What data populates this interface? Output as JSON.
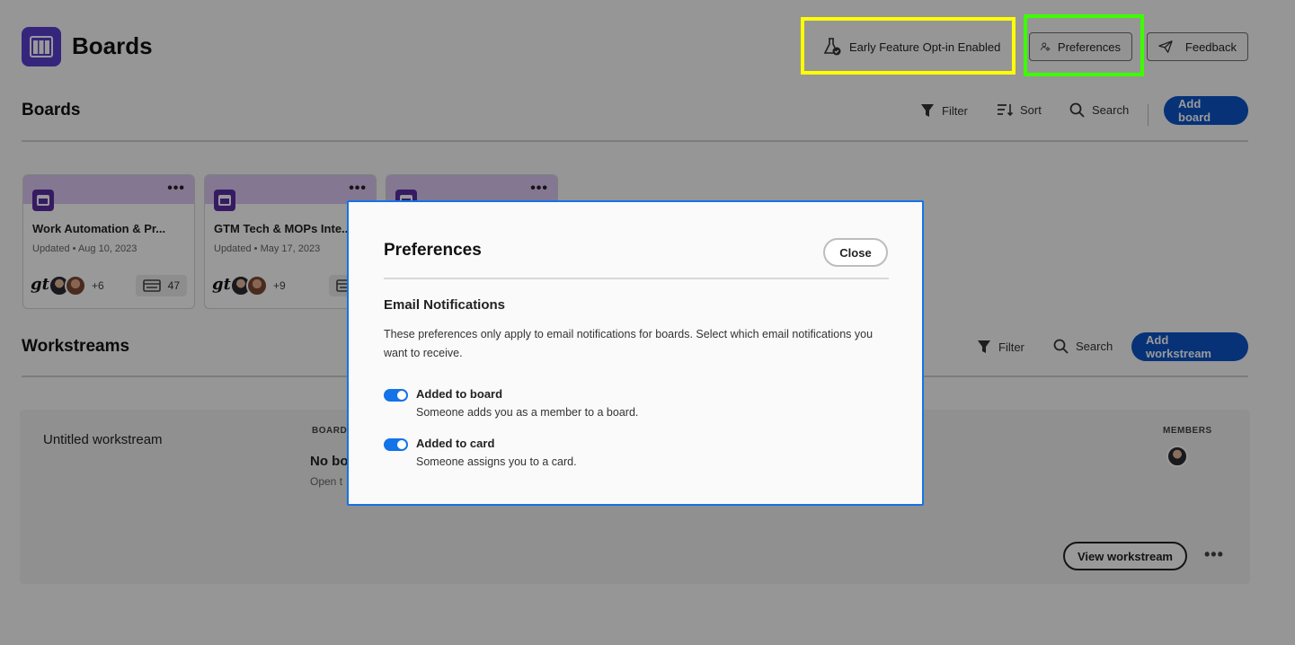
{
  "header": {
    "app_title": "Boards",
    "early_feature_label": "Early Feature Opt-in Enabled",
    "preferences_label": "Preferences",
    "feedback_label": "Feedback"
  },
  "boards_section": {
    "title": "Boards",
    "filter_label": "Filter",
    "sort_label": "Sort",
    "search_label": "Search",
    "add_label": "Add board",
    "cards": [
      {
        "name": "Work Automation & Pr...",
        "updated_label": "Updated",
        "date": "Aug 10, 2023",
        "more_members": "+6",
        "count": "47"
      },
      {
        "name": "GTM Tech & MOPs Inte...",
        "updated_label": "Updated",
        "date": "May 17, 2023",
        "more_members": "+9",
        "count": ""
      },
      {
        "name": "",
        "updated_label": "",
        "date": "",
        "more_members": "",
        "count": ""
      }
    ]
  },
  "workstreams_section": {
    "title": "Workstreams",
    "filter_label": "Filter",
    "search_label": "Search",
    "add_label": "Add workstream",
    "item": {
      "name": "Untitled workstream",
      "boards_col": "BOARD",
      "empty_title": "No bo",
      "empty_sub": "Open t",
      "members_col": "MEMBERS",
      "view_label": "View workstream"
    }
  },
  "dialog": {
    "title": "Preferences",
    "close_label": "Close",
    "section_title": "Email Notifications",
    "description": "These preferences only apply to email notifications for boards. Select which email notifications you want to receive.",
    "options": [
      {
        "label": "Added to board",
        "sub": "Someone adds you as a member to a board.",
        "enabled": true
      },
      {
        "label": "Added to card",
        "sub": "Someone assigns you to a card.",
        "enabled": true
      }
    ]
  },
  "colors": {
    "accent": "#0d54c9",
    "highlight_yellow": "#ffff00",
    "highlight_green": "#3cff00",
    "dialog_border": "#1473e6",
    "card_band": "#ddc6f2"
  }
}
